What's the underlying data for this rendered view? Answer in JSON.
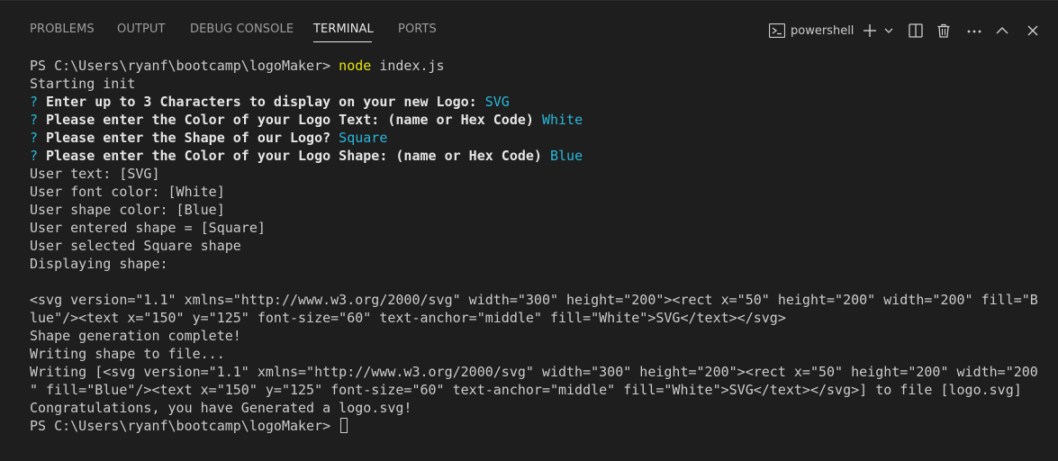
{
  "tabs": [
    {
      "label": "PROBLEMS"
    },
    {
      "label": "OUTPUT"
    },
    {
      "label": "DEBUG CONSOLE"
    },
    {
      "label": "TERMINAL",
      "active": true
    },
    {
      "label": "PORTS"
    }
  ],
  "actions": {
    "terminal_label": "powershell",
    "icons": [
      "terminal-icon",
      "plus-icon",
      "chevron-down-icon",
      "split-icon",
      "trash-icon",
      "ellipsis-icon",
      "chevron-up-icon",
      "close-icon"
    ]
  },
  "colors": {
    "background": "#1e1e1e",
    "prompt_mark": "#29b8db",
    "answer": "#29b8db",
    "command": "#e5e510",
    "text": "#cccccc"
  },
  "terminal": {
    "prompt1": "PS C:\\Users\\ryanf\\bootcamp\\logoMaker> ",
    "command": "node",
    "command_args": " index.js",
    "l_init": "Starting init",
    "q_mark": "?",
    "q1": " Enter up to 3 Characters to display on your new Logo:",
    "a1": " SVG",
    "q2": " Please enter the Color of your Logo Text: (name or Hex Code)",
    "a2": " White",
    "q3": " Please enter the Shape of our Logo?",
    "a3": " Square",
    "q4": " Please enter the Color of your Logo Shape: (name or Hex Code)",
    "a4": " Blue",
    "l_user_text": "User text: [SVG]",
    "l_font_color": "User font color: [White]",
    "l_shape_color": "User shape color: [Blue]",
    "l_entered_shape": "User entered shape = [Square]",
    "l_selected_shape": "User selected Square shape",
    "l_displaying": "Displaying shape:",
    "l_svg1": "<svg version=\"1.1\" xmlns=\"http://www.w3.org/2000/svg\" width=\"300\" height=\"200\"><rect x=\"50\" height=\"200\" width=\"200\" fill=\"B",
    "l_svg2": "lue\"/><text x=\"150\" y=\"125\" font-size=\"60\" text-anchor=\"middle\" fill=\"White\">SVG</text></svg>",
    "l_complete": "Shape generation complete!",
    "l_writing": "Writing shape to file...",
    "l_writing1": "Writing [<svg version=\"1.1\" xmlns=\"http://www.w3.org/2000/svg\" width=\"300\" height=\"200\"><rect x=\"50\" height=\"200\" width=\"200",
    "l_writing2": "\" fill=\"Blue\"/><text x=\"150\" y=\"125\" font-size=\"60\" text-anchor=\"middle\" fill=\"White\">SVG</text></svg>] to file [logo.svg]",
    "l_congrats": "Congratulations, you have Generated a logo.svg!",
    "prompt2": "PS C:\\Users\\ryanf\\bootcamp\\logoMaker> "
  }
}
